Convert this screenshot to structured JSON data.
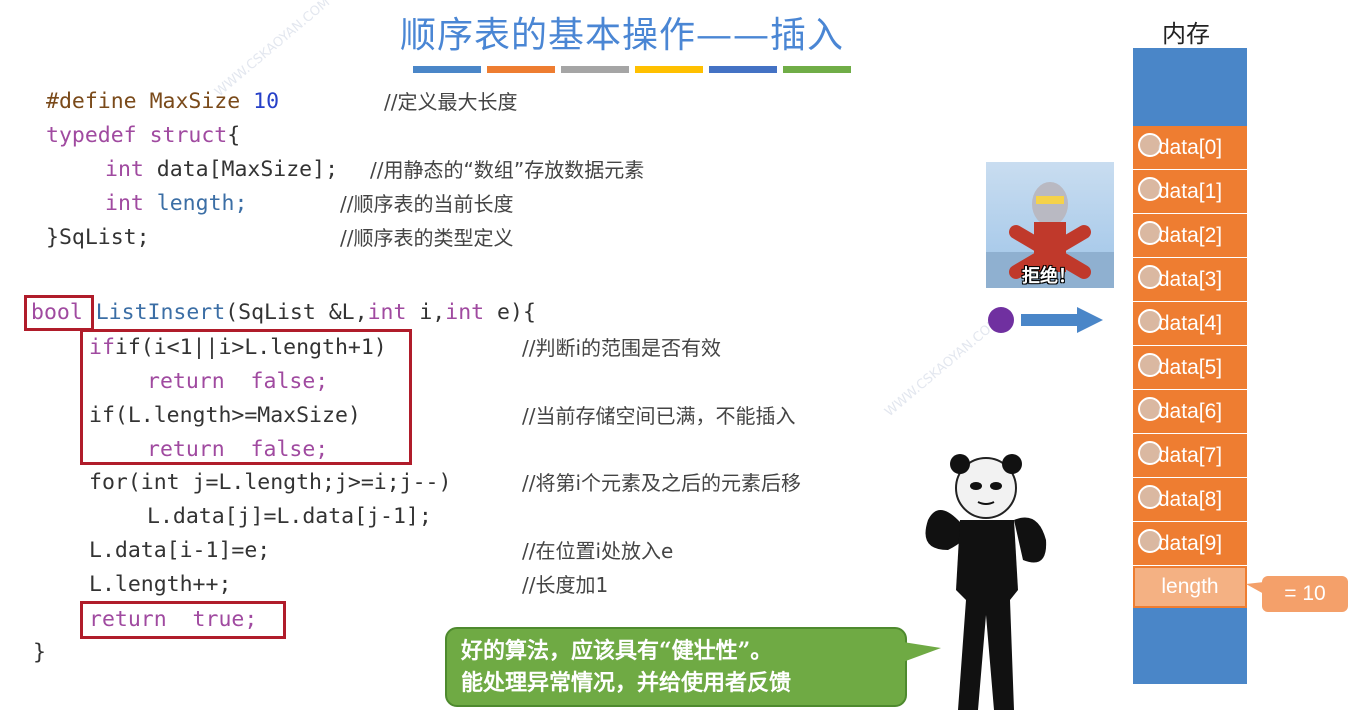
{
  "title": "顺序表的基本操作——插入",
  "title_bar_colors": [
    "#4a86c8",
    "#ee7d31",
    "#a5a5a5",
    "#ffc000",
    "#4472c4",
    "#70ad47"
  ],
  "code": {
    "define_kw": "#define",
    "define_name": "MaxSize",
    "define_val": "10",
    "define_cmt": "//定义最大长度",
    "typedef_line": "typedef struct{",
    "typedef_kw1": "typedef",
    "typedef_kw2": "struct",
    "typedef_brace": "{",
    "field1_type": "int",
    "field1_rest": "data[MaxSize];",
    "field1_cmt": "//用静态的“数组”存放数据元素",
    "field2_type": "int",
    "field2_rest": "length;",
    "field2_cmt": "//顺序表的当前长度",
    "struct_end": "}SqList;",
    "struct_end_cmt": "//顺序表的类型定义",
    "fn_ret": "bool",
    "fn_name": "ListInsert",
    "fn_params_a": "(SqList &L,",
    "fn_int1": "int",
    "fn_params_b": " i,",
    "fn_int2": "int",
    "fn_params_c": " e){",
    "if1": "if(i<1||i>L.length+1)",
    "if1_cmt": "//判断i的范围是否有效",
    "ret_false1": "return  false;",
    "if2": "if(L.length>=MaxSize)",
    "if2_cmt": "//当前存储空间已满，不能插入",
    "ret_false2": "return  false;",
    "for_line": "for(int j=L.length;j>=i;j--)",
    "for_cmt": "//将第i个元素及之后的元素后移",
    "shift_line": "L.data[j]=L.data[j-1];",
    "assign_line": "L.data[i-1]=e;",
    "assign_cmt": "//在位置i处放入e",
    "inc_line": "L.length++;",
    "inc_cmt": "//长度加1",
    "ret_true": "return  true;",
    "close_brace": "}"
  },
  "memory": {
    "title": "内存",
    "cells": [
      "data[0]",
      "data[1]",
      "data[2]",
      "data[3]",
      "data[4]",
      "data[5]",
      "data[6]",
      "data[7]",
      "data[8]",
      "data[9]"
    ],
    "length_label": "length",
    "length_value": "= 10"
  },
  "sticker_text": "拒绝！",
  "bubble": {
    "line1": "好的算法，应该具有“健壮性”。",
    "line2": "能处理异常情况，并给使用者反馈"
  },
  "watermark": "WWW.CSKAOYAN.COM"
}
